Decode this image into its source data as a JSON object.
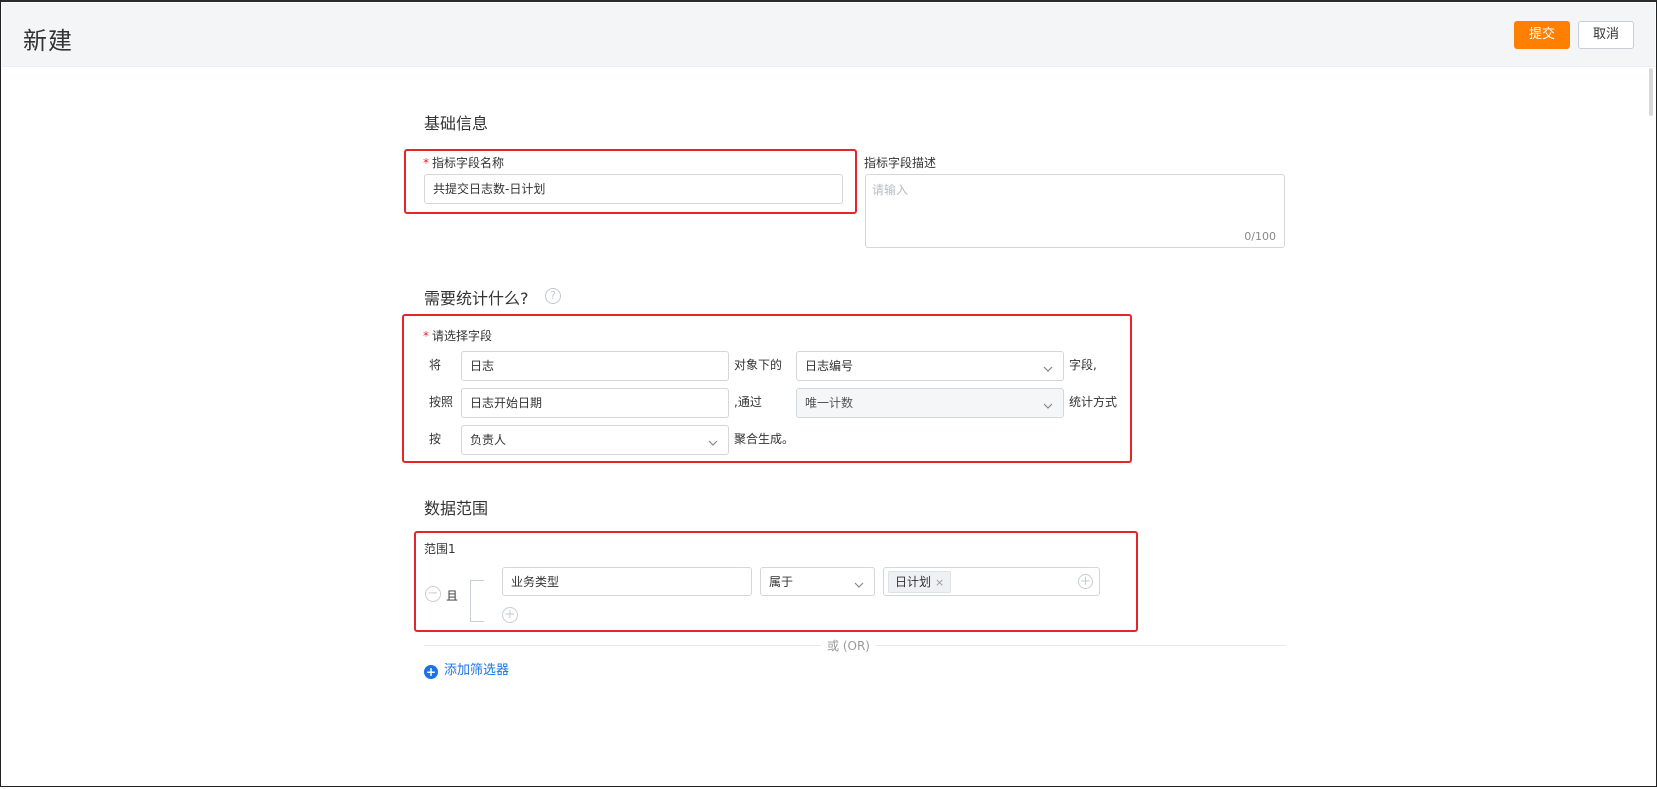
{
  "header": {
    "title": "新建",
    "submit_label": "提交",
    "cancel_label": "取消"
  },
  "basic": {
    "section_title": "基础信息",
    "name_label": "指标字段名称",
    "name_value": "共提交日志数-日计划",
    "desc_label": "指标字段描述",
    "desc_placeholder": "请输入",
    "desc_counter": "0/100"
  },
  "stat": {
    "section_title": "需要统计什么?",
    "help_icon": "?",
    "field_label": "请选择字段",
    "row1": {
      "prefix": "将",
      "object": "日志",
      "mid": "对象下的",
      "field": "日志编号",
      "suffix": "字段,"
    },
    "row2": {
      "prefix": "按照",
      "date_field": "日志开始日期",
      "mid": ",通过",
      "method": "唯一计数",
      "suffix": "统计方式"
    },
    "row3": {
      "prefix": "按",
      "group_field": "负责人",
      "suffix": "聚合生成。"
    }
  },
  "scope": {
    "section_title": "数据范围",
    "range_label": "范围1",
    "logic_label": "且",
    "condition": {
      "field": "业务类型",
      "operator": "属于",
      "value_tag": "日计划"
    },
    "or_label": "或 (OR)",
    "add_filter_label": "添加筛选器"
  },
  "colors": {
    "primary": "#ff8000",
    "highlight": "#e8242b",
    "link": "#1a73e8"
  }
}
